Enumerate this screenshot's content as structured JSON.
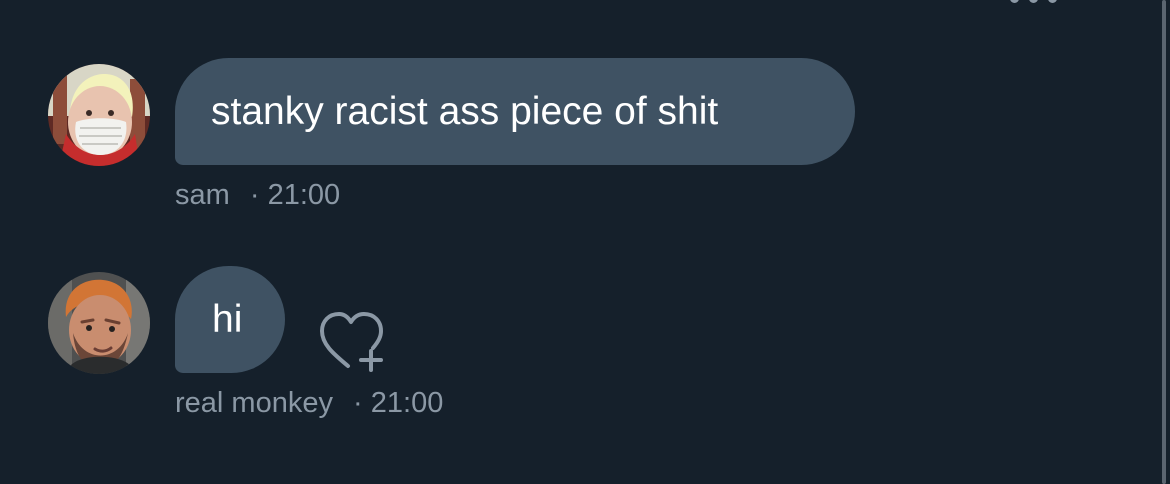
{
  "colors": {
    "background": "#15202b",
    "bubble": "#3f5263",
    "message_text": "#ffffff",
    "meta_text": "#8b98a5"
  },
  "messages": [
    {
      "text": "stanky racist ass piece of shit",
      "sender": "sam",
      "separator": "·",
      "time": "21:00",
      "avatar_icon": "masked-person-avatar"
    },
    {
      "text": "hi",
      "sender": "real monkey",
      "separator": "·",
      "time": "21:00",
      "avatar_icon": "orange-haired-person-avatar",
      "reaction_icon": "heart-plus-icon"
    }
  ]
}
